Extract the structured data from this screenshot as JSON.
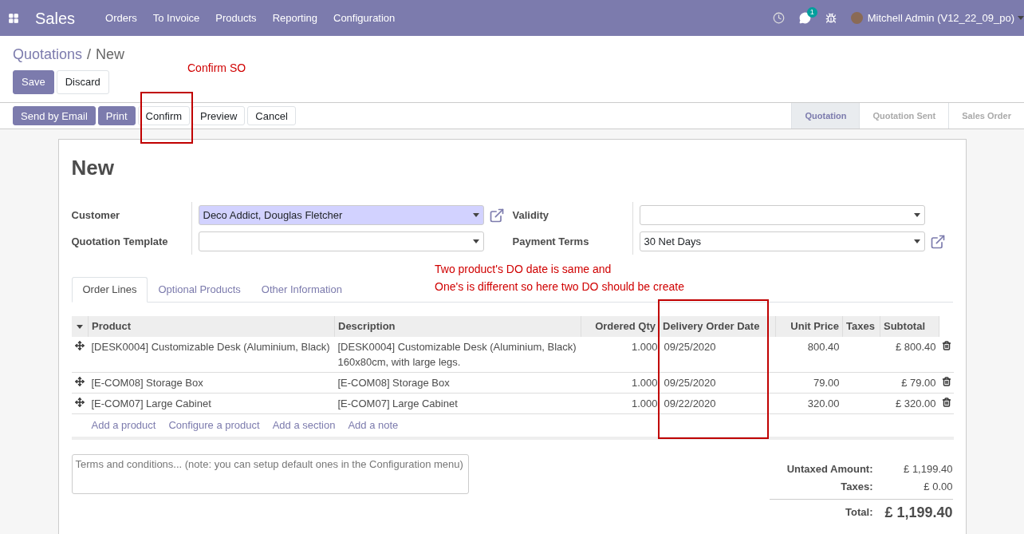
{
  "app": {
    "name": "Sales"
  },
  "menu": [
    "Orders",
    "To Invoice",
    "Products",
    "Reporting",
    "Configuration"
  ],
  "systray": {
    "message_count": "1",
    "user": "Mitchell Admin (V12_22_09_po)"
  },
  "breadcrumb": {
    "parent": "Quotations",
    "separator": "/",
    "current": "New"
  },
  "edit_buttons": [
    {
      "label": "Save",
      "kind": "primary"
    },
    {
      "label": "Discard",
      "kind": "secondary"
    }
  ],
  "action_buttons": [
    {
      "label": "Send by Email",
      "kind": "primary"
    },
    {
      "label": "Print",
      "kind": "primary"
    },
    {
      "label": "Confirm",
      "kind": "secondary"
    },
    {
      "label": "Preview",
      "kind": "secondary"
    },
    {
      "label": "Cancel",
      "kind": "secondary"
    }
  ],
  "stages": [
    {
      "label": "Quotation",
      "selected": true
    },
    {
      "label": "Quotation Sent",
      "selected": false
    },
    {
      "label": "Sales Order",
      "selected": false
    }
  ],
  "annotations": {
    "confirm_note": "Confirm SO",
    "do_note": [
      "Two product's DO date is same and",
      "One's is different so here two DO should be create"
    ]
  },
  "form": {
    "title": "New",
    "left_fields": [
      {
        "label": "Customer",
        "value": "Deco Addict, Douglas Fletcher",
        "required": true,
        "external_link": true
      },
      {
        "label": "Quotation Template",
        "required": false,
        "external_link": false
      }
    ],
    "right_fields": [
      {
        "label": "Validity",
        "required": false,
        "external_link": false
      },
      {
        "label": "Payment Terms",
        "value": "30 Net Days",
        "required": false,
        "external_link": true
      }
    ],
    "tabs": [
      {
        "label": "Order Lines",
        "selected": true
      },
      {
        "label": "Optional Products",
        "selected": false
      },
      {
        "label": "Other Information",
        "selected": false
      }
    ],
    "table": {
      "columns": [
        "Product",
        "Description",
        "Ordered Qty",
        "Delivery Order Date",
        "Unit Price",
        "Taxes",
        "Subtotal"
      ],
      "rows": [
        {
          "product": "[DESK0004] Customizable Desk (Aluminium, Black)",
          "description": [
            "[DESK0004] Customizable Desk (Aluminium, Black)",
            "160x80cm, with large legs."
          ],
          "qty": "1.000",
          "delivery_date": "09/25/2020",
          "unit_price": "800.40",
          "subtotal": "£ 800.40"
        },
        {
          "product": "[E-COM08] Storage Box",
          "description": [
            "[E-COM08] Storage Box"
          ],
          "qty": "1.000",
          "delivery_date": "09/25/2020",
          "unit_price": "79.00",
          "subtotal": "£ 79.00"
        },
        {
          "product": "[E-COM07] Large Cabinet",
          "description": [
            "[E-COM07] Large Cabinet"
          ],
          "qty": "1.000",
          "delivery_date": "09/22/2020",
          "unit_price": "320.00",
          "subtotal": "£ 320.00"
        }
      ],
      "add_links": [
        "Add a product",
        "Configure a product",
        "Add a section",
        "Add a note"
      ]
    },
    "terms": {
      "placeholder": "Terms and conditions... (note: you can setup default ones in the Configuration menu)"
    },
    "totals": [
      {
        "label": "Untaxed Amount:",
        "value": "£ 1,199.40",
        "kind": "line"
      },
      {
        "label": "Taxes:",
        "value": "£ 0.00",
        "kind": "line"
      },
      {
        "label": "Total:",
        "value": "£ 1,199.40",
        "kind": "grand"
      }
    ]
  }
}
